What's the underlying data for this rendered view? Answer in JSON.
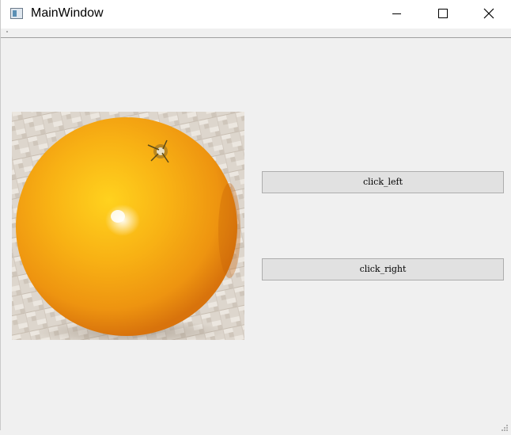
{
  "window": {
    "title": "MainWindow",
    "controls": {
      "minimize_icon": "minimize-icon",
      "maximize_icon": "maximize-icon",
      "close_icon": "close-icon"
    }
  },
  "content": {
    "image": "orange",
    "buttons": {
      "left_label": "click_left",
      "right_label": "click_right"
    }
  },
  "colors": {
    "window_bg": "#f0f0f0",
    "button_bg": "#e1e1e1",
    "button_border": "#adadad",
    "orange": "#f3a81f"
  }
}
